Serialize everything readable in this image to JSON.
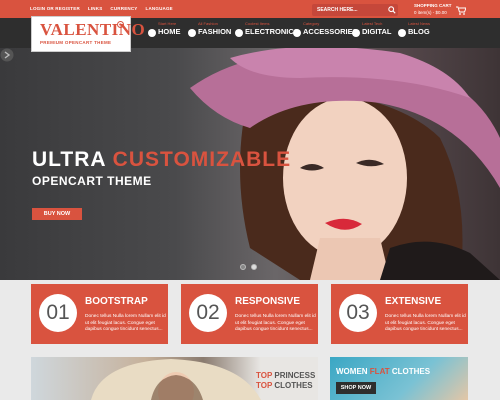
{
  "top_links": [
    "LOGIN OR REGISTER",
    "LINKS",
    "CURRENCY",
    "LANGUAGE"
  ],
  "logo": {
    "title": "VALENTINO",
    "reg": "®",
    "subtitle": "PREMIUM OPENCART THEME"
  },
  "search": {
    "placeholder": "SEARCH HERE..."
  },
  "cart": {
    "title": "SHOPPING CART",
    "total": "0 item(s) - $0.00"
  },
  "nav": [
    {
      "label": "HOME",
      "sub": "Start Here",
      "icon": "home-icon"
    },
    {
      "label": "FASHION",
      "sub": "All Fashion",
      "icon": "fashion-icon"
    },
    {
      "label": "ELECTRONICS",
      "sub": "Coolest Items",
      "icon": "electronics-icon"
    },
    {
      "label": "ACCESSORIES",
      "sub": "Category",
      "icon": "accessories-icon"
    },
    {
      "label": "DIGITAL",
      "sub": "Latest Tech",
      "icon": "digital-icon"
    },
    {
      "label": "BLOG",
      "sub": "Latest News",
      "icon": "blog-icon"
    }
  ],
  "hero": {
    "title_white": "ULTRA",
    "title_accent": "CUSTOMIZABLE",
    "subtitle": "OPENCART THEME",
    "button": "BUY NOW"
  },
  "features": [
    {
      "num": "01",
      "title": "BOOTSTRAP",
      "text": "Donec tellus Nulla lorem Nullam elit id ut elit feugiat lacus. Congue eget dapibus congue tincidunt senectus..."
    },
    {
      "num": "02",
      "title": "RESPONSIVE",
      "text": "Donec tellus Nulla lorem Nullam elit id ut elit feugiat lacus. Congue eget dapibus congue tincidunt senectus..."
    },
    {
      "num": "03",
      "title": "EXTENSIVE",
      "text": "Donec tellus Nulla lorem Nullam elit id ut elit feugiat lacus. Congue eget dapibus congue tincidunt senectus..."
    }
  ],
  "banner1": {
    "line1_accent": "TOP",
    "line1_dark": "PRINCESS",
    "line2_accent": "TOP",
    "line2_dark": "CLOTHES"
  },
  "banner2": {
    "white": "WOMEN",
    "accent": "FLAT",
    "white2": "CLOTHES",
    "button": "SHOP NOW"
  },
  "colors": {
    "accent": "#d9533f",
    "dark": "#2e2e2e"
  }
}
